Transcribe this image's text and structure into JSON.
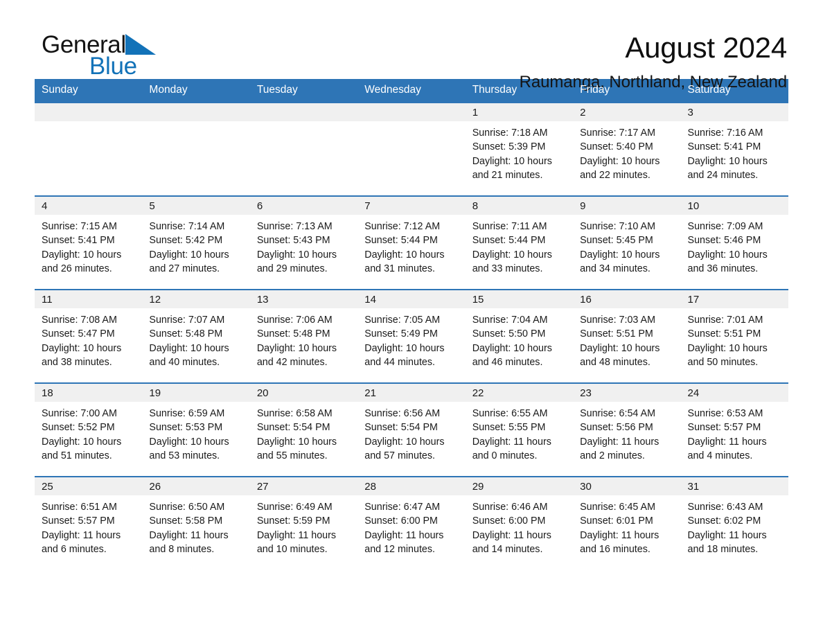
{
  "brand": {
    "name_part1": "General",
    "name_part2": "Blue",
    "triangle_color": "#1272b8",
    "text_color": "#141414"
  },
  "header": {
    "month_title": "August 2024",
    "location": "Raumanga, Northland, New Zealand",
    "header_bg": "#2e75b6",
    "row_rule_color": "#2e75b6",
    "daynum_bg": "#f0f0f0"
  },
  "weekday_headers": [
    "Sunday",
    "Monday",
    "Tuesday",
    "Wednesday",
    "Thursday",
    "Friday",
    "Saturday"
  ],
  "weeks": [
    [
      {
        "day": "",
        "sunrise": "",
        "sunset": "",
        "daylight_line1": "",
        "daylight_line2": "",
        "empty": true
      },
      {
        "day": "",
        "sunrise": "",
        "sunset": "",
        "daylight_line1": "",
        "daylight_line2": "",
        "empty": true
      },
      {
        "day": "",
        "sunrise": "",
        "sunset": "",
        "daylight_line1": "",
        "daylight_line2": "",
        "empty": true
      },
      {
        "day": "",
        "sunrise": "",
        "sunset": "",
        "daylight_line1": "",
        "daylight_line2": "",
        "empty": true
      },
      {
        "day": "1",
        "sunrise": "Sunrise: 7:18 AM",
        "sunset": "Sunset: 5:39 PM",
        "daylight_line1": "Daylight: 10 hours",
        "daylight_line2": "and 21 minutes.",
        "empty": false
      },
      {
        "day": "2",
        "sunrise": "Sunrise: 7:17 AM",
        "sunset": "Sunset: 5:40 PM",
        "daylight_line1": "Daylight: 10 hours",
        "daylight_line2": "and 22 minutes.",
        "empty": false
      },
      {
        "day": "3",
        "sunrise": "Sunrise: 7:16 AM",
        "sunset": "Sunset: 5:41 PM",
        "daylight_line1": "Daylight: 10 hours",
        "daylight_line2": "and 24 minutes.",
        "empty": false
      }
    ],
    [
      {
        "day": "4",
        "sunrise": "Sunrise: 7:15 AM",
        "sunset": "Sunset: 5:41 PM",
        "daylight_line1": "Daylight: 10 hours",
        "daylight_line2": "and 26 minutes.",
        "empty": false
      },
      {
        "day": "5",
        "sunrise": "Sunrise: 7:14 AM",
        "sunset": "Sunset: 5:42 PM",
        "daylight_line1": "Daylight: 10 hours",
        "daylight_line2": "and 27 minutes.",
        "empty": false
      },
      {
        "day": "6",
        "sunrise": "Sunrise: 7:13 AM",
        "sunset": "Sunset: 5:43 PM",
        "daylight_line1": "Daylight: 10 hours",
        "daylight_line2": "and 29 minutes.",
        "empty": false
      },
      {
        "day": "7",
        "sunrise": "Sunrise: 7:12 AM",
        "sunset": "Sunset: 5:44 PM",
        "daylight_line1": "Daylight: 10 hours",
        "daylight_line2": "and 31 minutes.",
        "empty": false
      },
      {
        "day": "8",
        "sunrise": "Sunrise: 7:11 AM",
        "sunset": "Sunset: 5:44 PM",
        "daylight_line1": "Daylight: 10 hours",
        "daylight_line2": "and 33 minutes.",
        "empty": false
      },
      {
        "day": "9",
        "sunrise": "Sunrise: 7:10 AM",
        "sunset": "Sunset: 5:45 PM",
        "daylight_line1": "Daylight: 10 hours",
        "daylight_line2": "and 34 minutes.",
        "empty": false
      },
      {
        "day": "10",
        "sunrise": "Sunrise: 7:09 AM",
        "sunset": "Sunset: 5:46 PM",
        "daylight_line1": "Daylight: 10 hours",
        "daylight_line2": "and 36 minutes.",
        "empty": false
      }
    ],
    [
      {
        "day": "11",
        "sunrise": "Sunrise: 7:08 AM",
        "sunset": "Sunset: 5:47 PM",
        "daylight_line1": "Daylight: 10 hours",
        "daylight_line2": "and 38 minutes.",
        "empty": false
      },
      {
        "day": "12",
        "sunrise": "Sunrise: 7:07 AM",
        "sunset": "Sunset: 5:48 PM",
        "daylight_line1": "Daylight: 10 hours",
        "daylight_line2": "and 40 minutes.",
        "empty": false
      },
      {
        "day": "13",
        "sunrise": "Sunrise: 7:06 AM",
        "sunset": "Sunset: 5:48 PM",
        "daylight_line1": "Daylight: 10 hours",
        "daylight_line2": "and 42 minutes.",
        "empty": false
      },
      {
        "day": "14",
        "sunrise": "Sunrise: 7:05 AM",
        "sunset": "Sunset: 5:49 PM",
        "daylight_line1": "Daylight: 10 hours",
        "daylight_line2": "and 44 minutes.",
        "empty": false
      },
      {
        "day": "15",
        "sunrise": "Sunrise: 7:04 AM",
        "sunset": "Sunset: 5:50 PM",
        "daylight_line1": "Daylight: 10 hours",
        "daylight_line2": "and 46 minutes.",
        "empty": false
      },
      {
        "day": "16",
        "sunrise": "Sunrise: 7:03 AM",
        "sunset": "Sunset: 5:51 PM",
        "daylight_line1": "Daylight: 10 hours",
        "daylight_line2": "and 48 minutes.",
        "empty": false
      },
      {
        "day": "17",
        "sunrise": "Sunrise: 7:01 AM",
        "sunset": "Sunset: 5:51 PM",
        "daylight_line1": "Daylight: 10 hours",
        "daylight_line2": "and 50 minutes.",
        "empty": false
      }
    ],
    [
      {
        "day": "18",
        "sunrise": "Sunrise: 7:00 AM",
        "sunset": "Sunset: 5:52 PM",
        "daylight_line1": "Daylight: 10 hours",
        "daylight_line2": "and 51 minutes.",
        "empty": false
      },
      {
        "day": "19",
        "sunrise": "Sunrise: 6:59 AM",
        "sunset": "Sunset: 5:53 PM",
        "daylight_line1": "Daylight: 10 hours",
        "daylight_line2": "and 53 minutes.",
        "empty": false
      },
      {
        "day": "20",
        "sunrise": "Sunrise: 6:58 AM",
        "sunset": "Sunset: 5:54 PM",
        "daylight_line1": "Daylight: 10 hours",
        "daylight_line2": "and 55 minutes.",
        "empty": false
      },
      {
        "day": "21",
        "sunrise": "Sunrise: 6:56 AM",
        "sunset": "Sunset: 5:54 PM",
        "daylight_line1": "Daylight: 10 hours",
        "daylight_line2": "and 57 minutes.",
        "empty": false
      },
      {
        "day": "22",
        "sunrise": "Sunrise: 6:55 AM",
        "sunset": "Sunset: 5:55 PM",
        "daylight_line1": "Daylight: 11 hours",
        "daylight_line2": "and 0 minutes.",
        "empty": false
      },
      {
        "day": "23",
        "sunrise": "Sunrise: 6:54 AM",
        "sunset": "Sunset: 5:56 PM",
        "daylight_line1": "Daylight: 11 hours",
        "daylight_line2": "and 2 minutes.",
        "empty": false
      },
      {
        "day": "24",
        "sunrise": "Sunrise: 6:53 AM",
        "sunset": "Sunset: 5:57 PM",
        "daylight_line1": "Daylight: 11 hours",
        "daylight_line2": "and 4 minutes.",
        "empty": false
      }
    ],
    [
      {
        "day": "25",
        "sunrise": "Sunrise: 6:51 AM",
        "sunset": "Sunset: 5:57 PM",
        "daylight_line1": "Daylight: 11 hours",
        "daylight_line2": "and 6 minutes.",
        "empty": false
      },
      {
        "day": "26",
        "sunrise": "Sunrise: 6:50 AM",
        "sunset": "Sunset: 5:58 PM",
        "daylight_line1": "Daylight: 11 hours",
        "daylight_line2": "and 8 minutes.",
        "empty": false
      },
      {
        "day": "27",
        "sunrise": "Sunrise: 6:49 AM",
        "sunset": "Sunset: 5:59 PM",
        "daylight_line1": "Daylight: 11 hours",
        "daylight_line2": "and 10 minutes.",
        "empty": false
      },
      {
        "day": "28",
        "sunrise": "Sunrise: 6:47 AM",
        "sunset": "Sunset: 6:00 PM",
        "daylight_line1": "Daylight: 11 hours",
        "daylight_line2": "and 12 minutes.",
        "empty": false
      },
      {
        "day": "29",
        "sunrise": "Sunrise: 6:46 AM",
        "sunset": "Sunset: 6:00 PM",
        "daylight_line1": "Daylight: 11 hours",
        "daylight_line2": "and 14 minutes.",
        "empty": false
      },
      {
        "day": "30",
        "sunrise": "Sunrise: 6:45 AM",
        "sunset": "Sunset: 6:01 PM",
        "daylight_line1": "Daylight: 11 hours",
        "daylight_line2": "and 16 minutes.",
        "empty": false
      },
      {
        "day": "31",
        "sunrise": "Sunrise: 6:43 AM",
        "sunset": "Sunset: 6:02 PM",
        "daylight_line1": "Daylight: 11 hours",
        "daylight_line2": "and 18 minutes.",
        "empty": false
      }
    ]
  ]
}
